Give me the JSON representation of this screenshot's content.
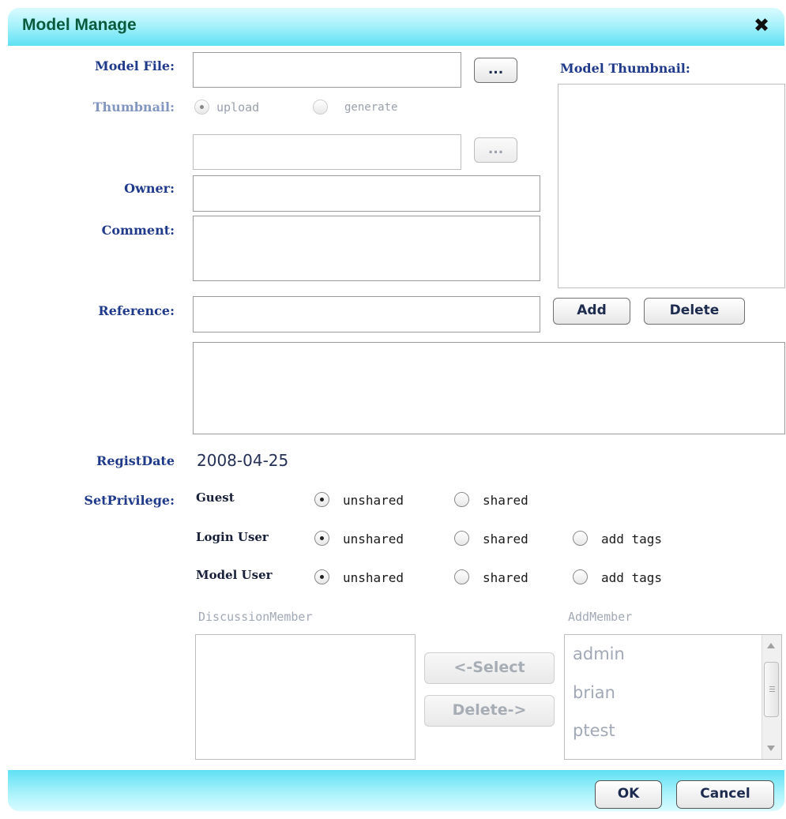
{
  "dialog": {
    "title": "Model Manage",
    "close_glyph": "✖"
  },
  "form": {
    "model_file_label": "Model File:",
    "model_file_value": "",
    "browse_label": "...",
    "thumbnail_label": "Thumbnail:",
    "thumb_upload": "upload",
    "thumb_generate": "generate",
    "thumbnail_file_value": "",
    "owner_label": "Owner:",
    "owner_value": "",
    "comment_label": "Comment:",
    "comment_value": "",
    "reference_label": "Reference:",
    "reference_value": "",
    "add_label": "Add",
    "delete_label": "Delete",
    "model_thumbnail_label": "Model Thumbnail:",
    "regist_date_label": "RegistDate",
    "regist_date_value": "2008-04-25",
    "set_privilege_label": "SetPrivilege:"
  },
  "privileges": {
    "guest": {
      "label": "Guest",
      "unshared": "unshared",
      "shared": "shared"
    },
    "login_user": {
      "label": "Login User",
      "unshared": "unshared",
      "shared": "shared",
      "add_tags": "add tags"
    },
    "model_user": {
      "label": "Model User",
      "unshared": "unshared",
      "shared": "shared",
      "add_tags": "add tags"
    }
  },
  "members": {
    "discussion_label": "DiscussionMember",
    "add_label": "AddMember",
    "select_button": "<-Select",
    "delete_button": "Delete->",
    "add_member_items": [
      "admin",
      "brian",
      "ptest"
    ]
  },
  "footer": {
    "ok_label": "OK",
    "cancel_label": "Cancel"
  },
  "colors": {
    "titlebar": "#5fe0f4",
    "title_text": "#0a5b3e",
    "label_text": "#1f3a8a"
  }
}
